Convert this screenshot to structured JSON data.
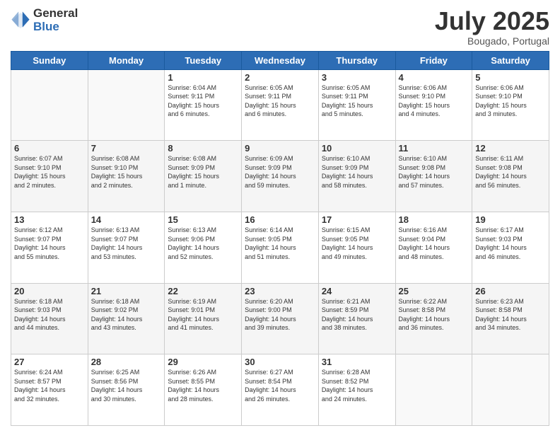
{
  "logo": {
    "line1": "General",
    "line2": "Blue"
  },
  "title": "July 2025",
  "subtitle": "Bougado, Portugal",
  "days_of_week": [
    "Sunday",
    "Monday",
    "Tuesday",
    "Wednesday",
    "Thursday",
    "Friday",
    "Saturday"
  ],
  "weeks": [
    [
      {
        "day": "",
        "info": ""
      },
      {
        "day": "",
        "info": ""
      },
      {
        "day": "1",
        "info": "Sunrise: 6:04 AM\nSunset: 9:11 PM\nDaylight: 15 hours\nand 6 minutes."
      },
      {
        "day": "2",
        "info": "Sunrise: 6:05 AM\nSunset: 9:11 PM\nDaylight: 15 hours\nand 6 minutes."
      },
      {
        "day": "3",
        "info": "Sunrise: 6:05 AM\nSunset: 9:11 PM\nDaylight: 15 hours\nand 5 minutes."
      },
      {
        "day": "4",
        "info": "Sunrise: 6:06 AM\nSunset: 9:10 PM\nDaylight: 15 hours\nand 4 minutes."
      },
      {
        "day": "5",
        "info": "Sunrise: 6:06 AM\nSunset: 9:10 PM\nDaylight: 15 hours\nand 3 minutes."
      }
    ],
    [
      {
        "day": "6",
        "info": "Sunrise: 6:07 AM\nSunset: 9:10 PM\nDaylight: 15 hours\nand 2 minutes."
      },
      {
        "day": "7",
        "info": "Sunrise: 6:08 AM\nSunset: 9:10 PM\nDaylight: 15 hours\nand 2 minutes."
      },
      {
        "day": "8",
        "info": "Sunrise: 6:08 AM\nSunset: 9:09 PM\nDaylight: 15 hours\nand 1 minute."
      },
      {
        "day": "9",
        "info": "Sunrise: 6:09 AM\nSunset: 9:09 PM\nDaylight: 14 hours\nand 59 minutes."
      },
      {
        "day": "10",
        "info": "Sunrise: 6:10 AM\nSunset: 9:09 PM\nDaylight: 14 hours\nand 58 minutes."
      },
      {
        "day": "11",
        "info": "Sunrise: 6:10 AM\nSunset: 9:08 PM\nDaylight: 14 hours\nand 57 minutes."
      },
      {
        "day": "12",
        "info": "Sunrise: 6:11 AM\nSunset: 9:08 PM\nDaylight: 14 hours\nand 56 minutes."
      }
    ],
    [
      {
        "day": "13",
        "info": "Sunrise: 6:12 AM\nSunset: 9:07 PM\nDaylight: 14 hours\nand 55 minutes."
      },
      {
        "day": "14",
        "info": "Sunrise: 6:13 AM\nSunset: 9:07 PM\nDaylight: 14 hours\nand 53 minutes."
      },
      {
        "day": "15",
        "info": "Sunrise: 6:13 AM\nSunset: 9:06 PM\nDaylight: 14 hours\nand 52 minutes."
      },
      {
        "day": "16",
        "info": "Sunrise: 6:14 AM\nSunset: 9:05 PM\nDaylight: 14 hours\nand 51 minutes."
      },
      {
        "day": "17",
        "info": "Sunrise: 6:15 AM\nSunset: 9:05 PM\nDaylight: 14 hours\nand 49 minutes."
      },
      {
        "day": "18",
        "info": "Sunrise: 6:16 AM\nSunset: 9:04 PM\nDaylight: 14 hours\nand 48 minutes."
      },
      {
        "day": "19",
        "info": "Sunrise: 6:17 AM\nSunset: 9:03 PM\nDaylight: 14 hours\nand 46 minutes."
      }
    ],
    [
      {
        "day": "20",
        "info": "Sunrise: 6:18 AM\nSunset: 9:03 PM\nDaylight: 14 hours\nand 44 minutes."
      },
      {
        "day": "21",
        "info": "Sunrise: 6:18 AM\nSunset: 9:02 PM\nDaylight: 14 hours\nand 43 minutes."
      },
      {
        "day": "22",
        "info": "Sunrise: 6:19 AM\nSunset: 9:01 PM\nDaylight: 14 hours\nand 41 minutes."
      },
      {
        "day": "23",
        "info": "Sunrise: 6:20 AM\nSunset: 9:00 PM\nDaylight: 14 hours\nand 39 minutes."
      },
      {
        "day": "24",
        "info": "Sunrise: 6:21 AM\nSunset: 8:59 PM\nDaylight: 14 hours\nand 38 minutes."
      },
      {
        "day": "25",
        "info": "Sunrise: 6:22 AM\nSunset: 8:58 PM\nDaylight: 14 hours\nand 36 minutes."
      },
      {
        "day": "26",
        "info": "Sunrise: 6:23 AM\nSunset: 8:58 PM\nDaylight: 14 hours\nand 34 minutes."
      }
    ],
    [
      {
        "day": "27",
        "info": "Sunrise: 6:24 AM\nSunset: 8:57 PM\nDaylight: 14 hours\nand 32 minutes."
      },
      {
        "day": "28",
        "info": "Sunrise: 6:25 AM\nSunset: 8:56 PM\nDaylight: 14 hours\nand 30 minutes."
      },
      {
        "day": "29",
        "info": "Sunrise: 6:26 AM\nSunset: 8:55 PM\nDaylight: 14 hours\nand 28 minutes."
      },
      {
        "day": "30",
        "info": "Sunrise: 6:27 AM\nSunset: 8:54 PM\nDaylight: 14 hours\nand 26 minutes."
      },
      {
        "day": "31",
        "info": "Sunrise: 6:28 AM\nSunset: 8:52 PM\nDaylight: 14 hours\nand 24 minutes."
      },
      {
        "day": "",
        "info": ""
      },
      {
        "day": "",
        "info": ""
      }
    ]
  ]
}
